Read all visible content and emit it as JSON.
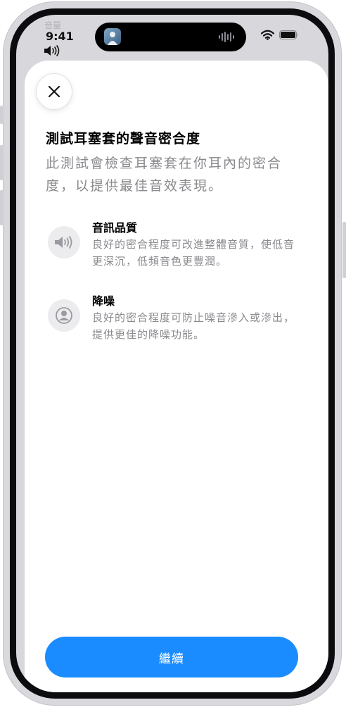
{
  "status_bar": {
    "time": "9:41",
    "behind_text": "音量"
  },
  "sheet": {
    "title": "測試耳塞套的聲音密合度",
    "subtitle": "此測試會檢查耳塞套在你耳內的密合度，以提供最佳音效表現。",
    "features": [
      {
        "icon": "speaker-icon",
        "title": "音訊品質",
        "description": "良好的密合程度可改進整體音質，使低音更深沉，低頻音色更豐潤。"
      },
      {
        "icon": "person-icon",
        "title": "降噪",
        "description": "良好的密合程度可防止噪音滲入或滲出，提供更佳的降噪功能。"
      }
    ],
    "continue_label": "繼續"
  },
  "colors": {
    "accent": "#1a8cff",
    "secondary_text": "#8a8a8e",
    "icon_circle": "#ececee"
  }
}
